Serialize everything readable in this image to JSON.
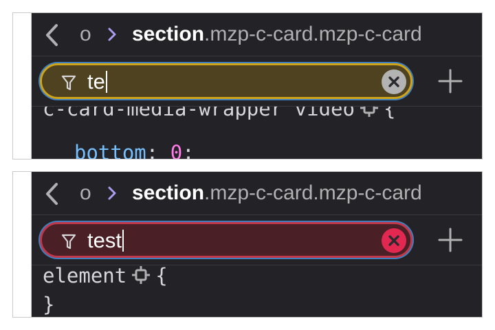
{
  "panels": [
    {
      "breadcrumb": {
        "previous": "o",
        "current_tag": "section",
        "current_classes": ".mzp-c-card.mzp-c-card"
      },
      "filter": {
        "value": "te",
        "state": "warning"
      },
      "code": {
        "selector_partial": "c-card-media-wrapper video",
        "open_brace": "{",
        "property": "bottom",
        "colon": ":",
        "value": "0",
        "semicolon": ";"
      },
      "colors": {
        "border": "#d0a419",
        "fill": "#4f4220",
        "clear": "#b3b3b3"
      }
    },
    {
      "breadcrumb": {
        "previous": "o",
        "current_tag": "section",
        "current_classes": ".mzp-c-card.mzp-c-card"
      },
      "filter": {
        "value": "test",
        "state": "error"
      },
      "code": {
        "selector": "element",
        "open_brace": "{",
        "close_brace": "}"
      },
      "colors": {
        "border": "#c0384a",
        "fill": "#4a2026",
        "clear": "#e22850"
      }
    }
  ],
  "icons": {
    "back": "chevron-left-icon",
    "separator": "chevron-right-icon",
    "filter": "funnel-icon",
    "clear": "close-icon",
    "add": "plus-icon",
    "node": "node-target-icon"
  }
}
